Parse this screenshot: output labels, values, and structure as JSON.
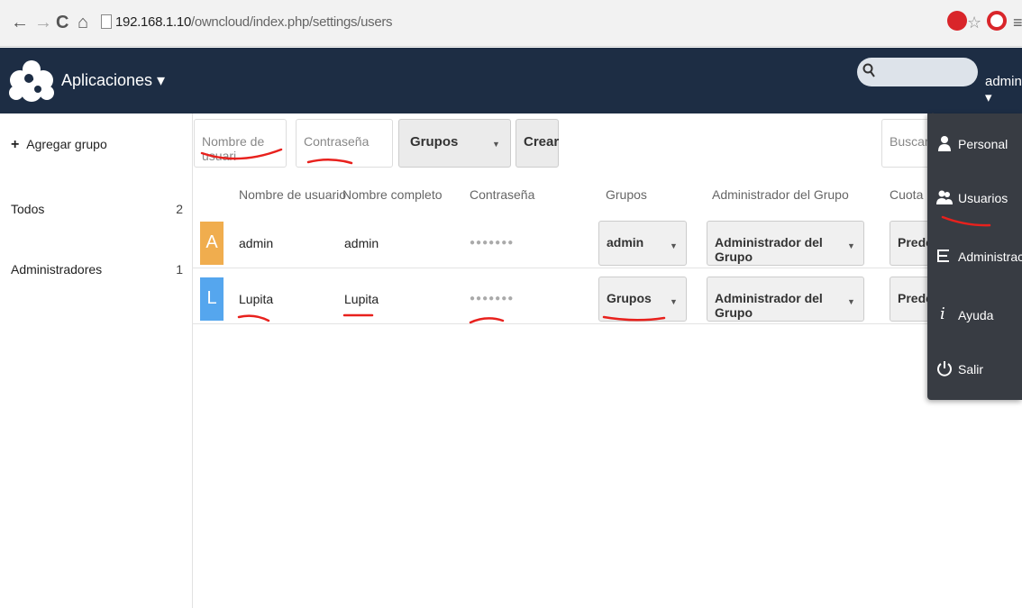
{
  "browser": {
    "url_host": "192.168.1.10",
    "url_path": "/owncloud/index.php/settings/users"
  },
  "header": {
    "apps_label": "Aplicaciones ▾",
    "user_label": "admin ▾",
    "search_placeholder": ""
  },
  "sidebar": {
    "add_group": "Agregar grupo",
    "groups": [
      {
        "label": "Todos",
        "count": "2"
      },
      {
        "label": "Administradores",
        "count": "1"
      }
    ]
  },
  "toolbar": {
    "username_placeholder": "Nombre de usuari",
    "password_placeholder": "Contraseña",
    "groups_label": "Grupos",
    "create_label": "Crear",
    "search_placeholder": "Buscar u"
  },
  "table": {
    "headers": [
      "Nombre de usuario",
      "Nombre completo",
      "Contraseña",
      "Grupos",
      "Administrador del Grupo",
      "Cuota"
    ],
    "rows": [
      {
        "initial": "A",
        "avatar_color": "#f0ad4e",
        "username": "admin",
        "fullname": "admin",
        "password": "●●●●●●●",
        "groups": "admin",
        "admin_group": "Administrador del Grupo",
        "quota": "Predet"
      },
      {
        "initial": "L",
        "avatar_color": "#55a6ee",
        "username": "Lupita",
        "fullname": "Lupita",
        "password": "●●●●●●●",
        "groups": "Grupos",
        "admin_group": "Administrador del Grupo",
        "quota": "Predet"
      }
    ]
  },
  "settings_menu": {
    "items": [
      {
        "label": "Personal",
        "icon": "person-icon"
      },
      {
        "label": "Usuarios",
        "icon": "users-icon"
      },
      {
        "label": "Administración",
        "icon": "admin-list-icon"
      },
      {
        "label": "Ayuda",
        "icon": "info-icon"
      },
      {
        "label": "Salir",
        "icon": "power-icon"
      }
    ]
  },
  "colors": {
    "header_bg": "#1d2d44",
    "menu_bg": "#383c43",
    "annotation": "#e8211d"
  }
}
